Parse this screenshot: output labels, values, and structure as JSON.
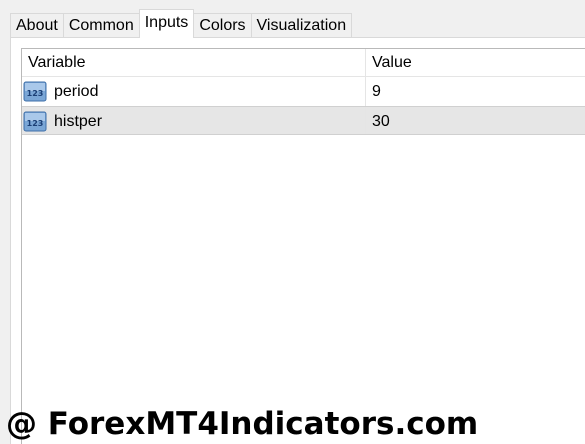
{
  "tabs": [
    {
      "label": "About"
    },
    {
      "label": "Common"
    },
    {
      "label": "Inputs"
    },
    {
      "label": "Colors"
    },
    {
      "label": "Visualization"
    }
  ],
  "active_tab": "Inputs",
  "inputs_table": {
    "columns": {
      "variable": "Variable",
      "value": "Value"
    },
    "rows": [
      {
        "icon": "integer-type-icon",
        "icon_text": "123",
        "variable": "period",
        "value": "9"
      },
      {
        "icon": "integer-type-icon",
        "icon_text": "123",
        "variable": "histper",
        "value": "30"
      }
    ],
    "selected_row_index": 1
  },
  "watermark": {
    "text": "@ ForexMT4Indicators.com"
  },
  "colors": {
    "background": "#f0f0f0",
    "panel": "#ffffff",
    "selected_row": "#e6e6e6",
    "icon_fill": "#7aa6d6",
    "icon_text": "#1b3f75"
  }
}
